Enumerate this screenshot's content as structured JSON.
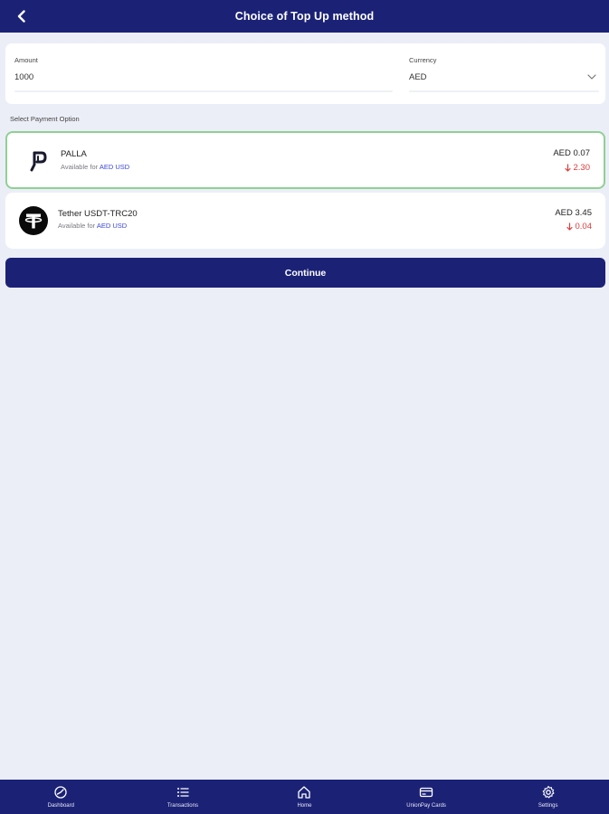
{
  "header": {
    "title": "Choice of Top Up method"
  },
  "form": {
    "amount_label": "Amount",
    "amount_value": "1000",
    "currency_label": "Currency",
    "currency_value": "AED"
  },
  "section_label": "Select Payment Option",
  "payment_options": [
    {
      "name": "PALLA",
      "available_prefix": "Available for",
      "currencies": "AED USD",
      "price": "AED 0.07",
      "change": "2.30",
      "selected": true
    },
    {
      "name": "Tether USDT-TRC20",
      "available_prefix": "Available for",
      "currencies": "AED USD",
      "price": "AED 3.45",
      "change": "0.04",
      "selected": false
    }
  ],
  "continue_label": "Continue",
  "bottom_nav": [
    {
      "label": "Dashboard",
      "icon": "dashboard-icon"
    },
    {
      "label": "Transactions",
      "icon": "list-icon"
    },
    {
      "label": "Home",
      "icon": "home-icon"
    },
    {
      "label": "UnionPay Cards",
      "icon": "card-icon"
    },
    {
      "label": "Settings",
      "icon": "gear-icon"
    }
  ],
  "colors": {
    "primary": "#1b2276",
    "background": "#eceef7",
    "selected_border": "#8fd095",
    "link": "#3a46d8",
    "negative": "#e03a3a"
  }
}
